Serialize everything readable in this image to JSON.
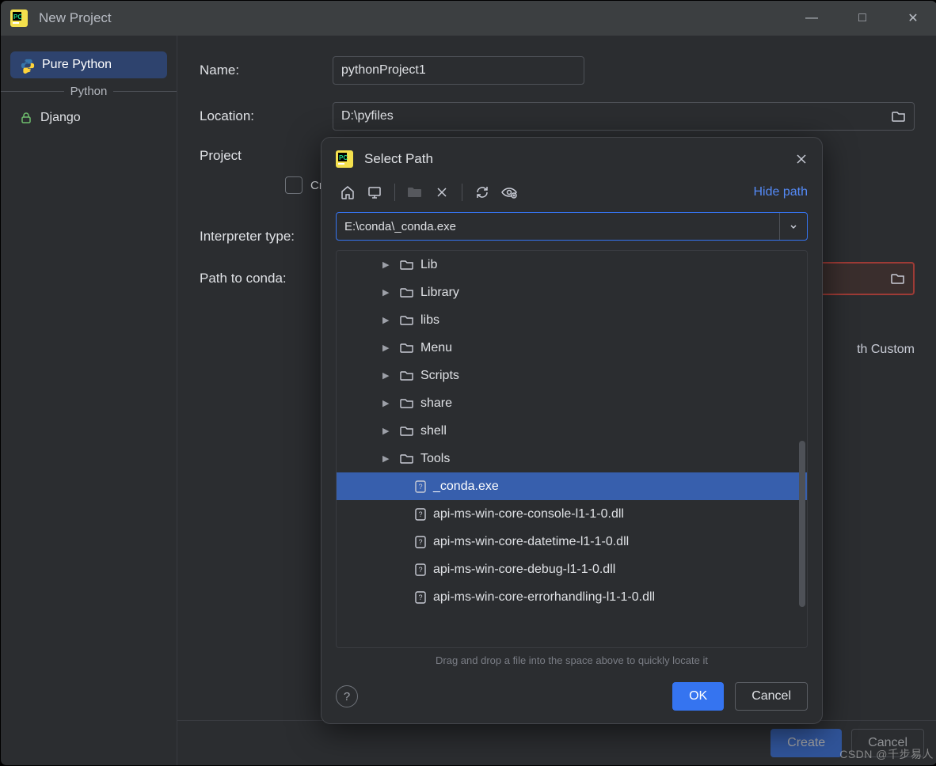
{
  "window": {
    "title": "New Project",
    "controls": {
      "min": "—",
      "max": "□",
      "close": "✕"
    }
  },
  "sidebar": {
    "group_label": "Python",
    "items": [
      {
        "label": "Pure Python",
        "icon": "python-icon",
        "selected": true
      },
      {
        "label": "Django",
        "icon": "lock-icon",
        "selected": false
      }
    ]
  },
  "form": {
    "name_label": "Name:",
    "name_value": "pythonProject1",
    "location_label": "Location:",
    "location_value": "D:\\pyfiles",
    "project_label_partial": "Project",
    "create_checkbox_partial": "Cre",
    "interpreter_label": "Interpreter type:",
    "path_conda_label": "Path to conda:",
    "custom_partial": "th Custom"
  },
  "footer": {
    "create": "Create",
    "cancel": "Cancel"
  },
  "modal": {
    "title": "Select Path",
    "hide_path": "Hide path",
    "path_value": "E:\\conda\\_conda.exe",
    "tree": [
      {
        "type": "folder",
        "label": "Lib"
      },
      {
        "type": "folder",
        "label": "Library"
      },
      {
        "type": "folder",
        "label": "libs"
      },
      {
        "type": "folder",
        "label": "Menu"
      },
      {
        "type": "folder",
        "label": "Scripts"
      },
      {
        "type": "folder",
        "label": "share"
      },
      {
        "type": "folder",
        "label": "shell"
      },
      {
        "type": "folder",
        "label": "Tools"
      },
      {
        "type": "file",
        "label": "_conda.exe",
        "selected": true
      },
      {
        "type": "file",
        "label": "api-ms-win-core-console-l1-1-0.dll"
      },
      {
        "type": "file",
        "label": "api-ms-win-core-datetime-l1-1-0.dll"
      },
      {
        "type": "file",
        "label": "api-ms-win-core-debug-l1-1-0.dll"
      },
      {
        "type": "file",
        "label": "api-ms-win-core-errorhandling-l1-1-0.dll"
      }
    ],
    "drag_hint": "Drag and drop a file into the space above to quickly locate it",
    "ok": "OK",
    "cancel": "Cancel"
  },
  "watermark": "CSDN @千步易人"
}
